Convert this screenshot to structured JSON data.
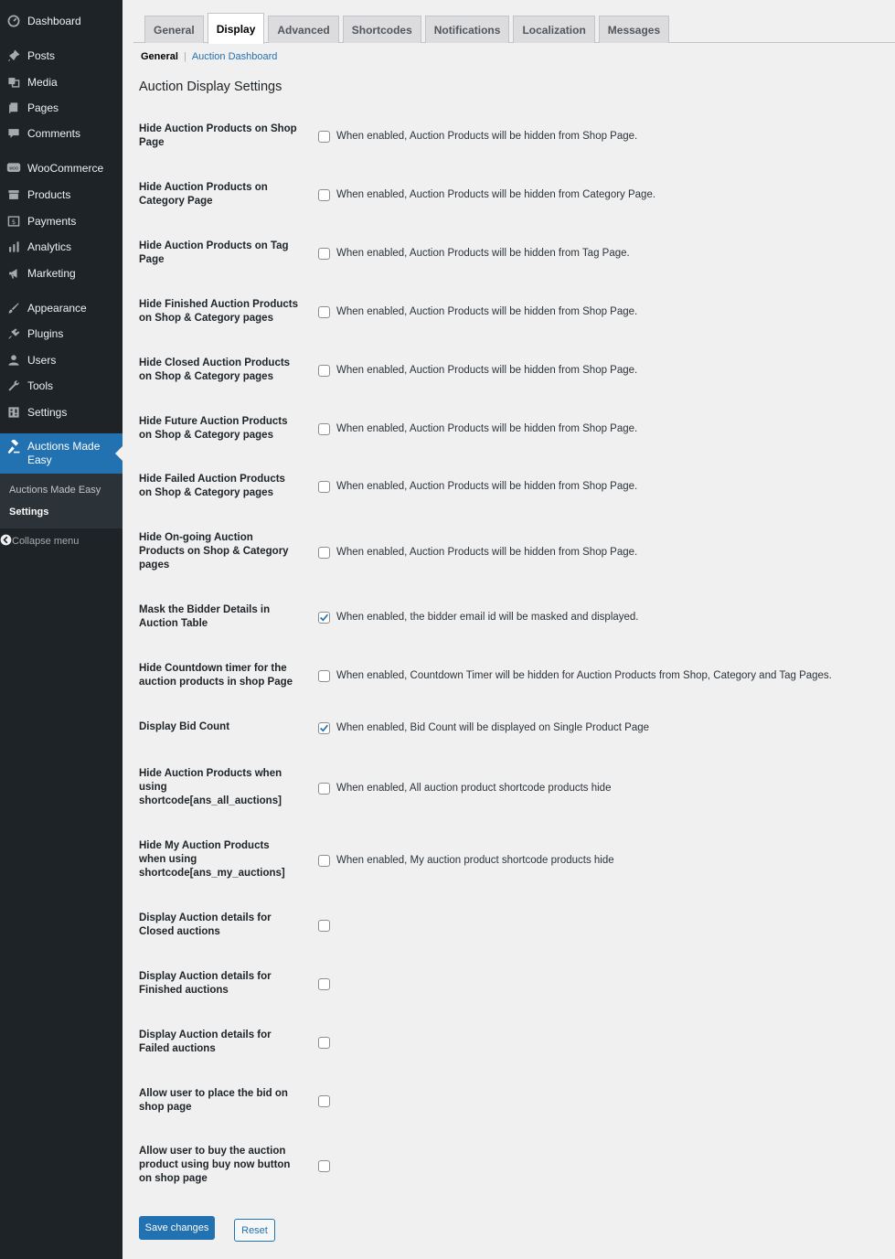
{
  "sidebar": {
    "items": [
      {
        "label": "Dashboard",
        "icon": "dashboard-icon"
      },
      {
        "label": "Posts",
        "icon": "pin-icon"
      },
      {
        "label": "Media",
        "icon": "media-icon"
      },
      {
        "label": "Pages",
        "icon": "pages-icon"
      },
      {
        "label": "Comments",
        "icon": "comment-icon"
      },
      {
        "label": "WooCommerce",
        "icon": "woo-icon"
      },
      {
        "label": "Products",
        "icon": "archive-icon"
      },
      {
        "label": "Payments",
        "icon": "money-icon"
      },
      {
        "label": "Analytics",
        "icon": "bar-chart-icon"
      },
      {
        "label": "Marketing",
        "icon": "megaphone-icon"
      },
      {
        "label": "Appearance",
        "icon": "paintbrush-icon"
      },
      {
        "label": "Plugins",
        "icon": "plug-icon"
      },
      {
        "label": "Users",
        "icon": "user-icon"
      },
      {
        "label": "Tools",
        "icon": "wrench-icon"
      },
      {
        "label": "Settings",
        "icon": "settings-icon"
      },
      {
        "label": "Auctions Made Easy",
        "icon": "gavel-icon"
      }
    ],
    "submenu": [
      "Auctions Made Easy",
      "Settings"
    ],
    "collapse_label": "Collapse menu"
  },
  "tabs": [
    "General",
    "Display",
    "Advanced",
    "Shortcodes",
    "Notifications",
    "Localization",
    "Messages"
  ],
  "active_tab": "Display",
  "subnav": {
    "current": "General",
    "separator": "|",
    "link": "Auction Dashboard"
  },
  "page_title": "Auction Display Settings",
  "settings": [
    {
      "label": "Hide Auction Products on Shop Page",
      "checked": false,
      "desc": "When enabled, Auction Products will be hidden from Shop Page."
    },
    {
      "label": "Hide Auction Products on Category Page",
      "checked": false,
      "desc": "When enabled, Auction Products will be hidden from Category Page."
    },
    {
      "label": "Hide Auction Products on Tag Page",
      "checked": false,
      "desc": "When enabled, Auction Products will be hidden from Tag Page."
    },
    {
      "label": "Hide Finished Auction Products on Shop & Category pages",
      "checked": false,
      "desc": "When enabled, Auction Products will be hidden from Shop Page."
    },
    {
      "label": "Hide Closed Auction Products on Shop & Category pages",
      "checked": false,
      "desc": "When enabled, Auction Products will be hidden from Shop Page."
    },
    {
      "label": "Hide Future Auction Products on Shop & Category pages",
      "checked": false,
      "desc": "When enabled, Auction Products will be hidden from Shop Page."
    },
    {
      "label": "Hide Failed Auction Products on Shop & Category pages",
      "checked": false,
      "desc": "When enabled, Auction Products will be hidden from Shop Page."
    },
    {
      "label": "Hide On-going Auction Products on Shop & Category pages",
      "checked": false,
      "desc": "When enabled, Auction Products will be hidden from Shop Page."
    },
    {
      "label": "Mask the Bidder Details in Auction Table",
      "checked": true,
      "desc": "When enabled, the bidder email id will be masked and displayed."
    },
    {
      "label": "Hide Countdown timer for the auction products in shop Page",
      "checked": false,
      "desc": "When enabled, Countdown Timer will be hidden for Auction Products from Shop, Category and Tag Pages."
    },
    {
      "label": "Display Bid Count",
      "checked": true,
      "desc": "When enabled, Bid Count will be displayed on Single Product Page"
    },
    {
      "label": "Hide Auction Products when using shortcode[ans_all_auctions]",
      "checked": false,
      "desc": "When enabled, All auction product shortcode products hide"
    },
    {
      "label": "Hide My Auction Products when using shortcode[ans_my_auctions]",
      "checked": false,
      "desc": "When enabled, My auction product shortcode products hide"
    },
    {
      "label": "Display Auction details for Closed auctions",
      "checked": false,
      "desc": ""
    },
    {
      "label": "Display Auction details for Finished auctions",
      "checked": false,
      "desc": ""
    },
    {
      "label": "Display Auction details for Failed auctions",
      "checked": false,
      "desc": ""
    },
    {
      "label": "Allow user to place the bid on shop page",
      "checked": false,
      "desc": ""
    },
    {
      "label": "Allow user to buy the auction product using buy now button on shop page",
      "checked": false,
      "desc": ""
    }
  ],
  "buttons": {
    "save": "Save changes",
    "reset": "Reset"
  },
  "colors": {
    "sidebar_bg": "#1d2327",
    "accent": "#2271b1",
    "page_bg": "#f0f0f1"
  }
}
